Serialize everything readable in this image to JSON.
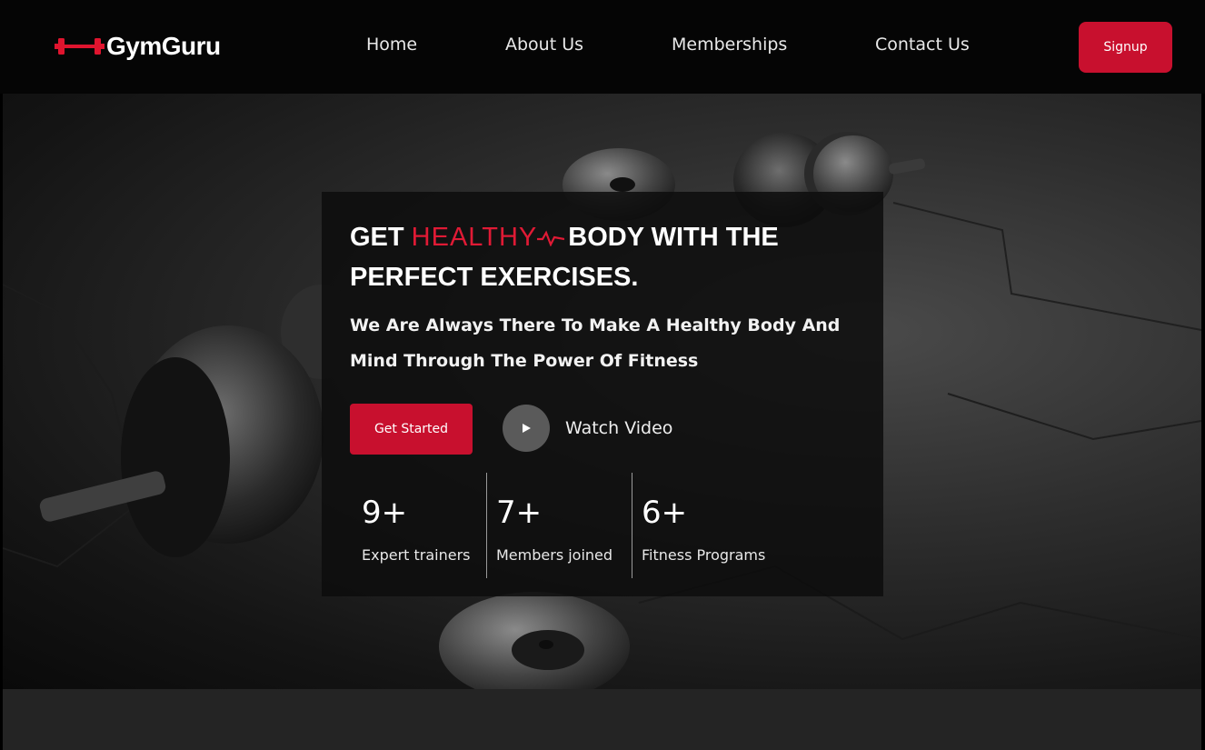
{
  "brand": {
    "name": "GymGuru",
    "icon": "dumbbell-icon",
    "accent": "#c8102e"
  },
  "nav": {
    "links": [
      "Home",
      "About Us",
      "Memberships",
      "Contact Us"
    ],
    "signup_label": "Signup"
  },
  "hero": {
    "headline_start": "GET ",
    "headline_highlight": "HEALTHY",
    "headline_rest": "BODY WITH THE PERFECT EXERCISES.",
    "subheadline": "We Are Always There To Make A Healthy Body And Mind Through The Power Of Fitness",
    "cta_label": "Get Started",
    "video_label": "Watch Video",
    "stats": [
      {
        "value": "9+",
        "label": "Expert trainers"
      },
      {
        "value": "7+",
        "label": "Members joined"
      },
      {
        "value": "6+",
        "label": "Fitness Programs"
      }
    ]
  }
}
